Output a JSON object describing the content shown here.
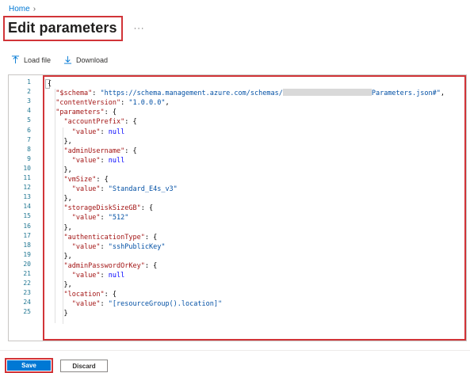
{
  "breadcrumb": {
    "home": "Home",
    "chevron": "›"
  },
  "page": {
    "title": "Edit parameters",
    "more": "···"
  },
  "toolbar": {
    "load_file": "Load file",
    "download": "Download"
  },
  "editor": {
    "line_numbers": [
      "1",
      "2",
      "3",
      "4",
      "5",
      "6",
      "7",
      "8",
      "9",
      "10",
      "11",
      "12",
      "13",
      "14",
      "15",
      "16",
      "17",
      "18",
      "19",
      "20",
      "21",
      "22",
      "23",
      "24",
      "25"
    ],
    "schema_key": "\"$schema\"",
    "schema_prefix": "\"https://schema.management.azure.com/schemas/",
    "schema_suffix": "Parameters.json#\"",
    "content_version_key": "\"contentVersion\"",
    "content_version_value": "\"1.0.0.0\"",
    "parameters_key": "\"parameters\"",
    "value_key": "\"value\"",
    "null": "null",
    "params": [
      {
        "name": "\"accountPrefix\"",
        "value": "null",
        "is_null": true
      },
      {
        "name": "\"adminUsername\"",
        "value": "null",
        "is_null": true
      },
      {
        "name": "\"vmSize\"",
        "value": "\"Standard_E4s_v3\"",
        "is_null": false
      },
      {
        "name": "\"storageDiskSizeGB\"",
        "value": "\"512\"",
        "is_null": false
      },
      {
        "name": "\"authenticationType\"",
        "value": "\"sshPublicKey\"",
        "is_null": false
      },
      {
        "name": "\"adminPasswordOrKey\"",
        "value": "null",
        "is_null": true
      },
      {
        "name": "\"location\"",
        "value": "\"[resourceGroup().location]\"",
        "is_null": false
      }
    ]
  },
  "footer": {
    "save": "Save",
    "discard": "Discard"
  },
  "colors": {
    "accent": "#0078d4",
    "highlight": "#d13438",
    "json_key": "#a31515",
    "json_string": "#0451a5",
    "json_keyword": "#0000ff"
  }
}
